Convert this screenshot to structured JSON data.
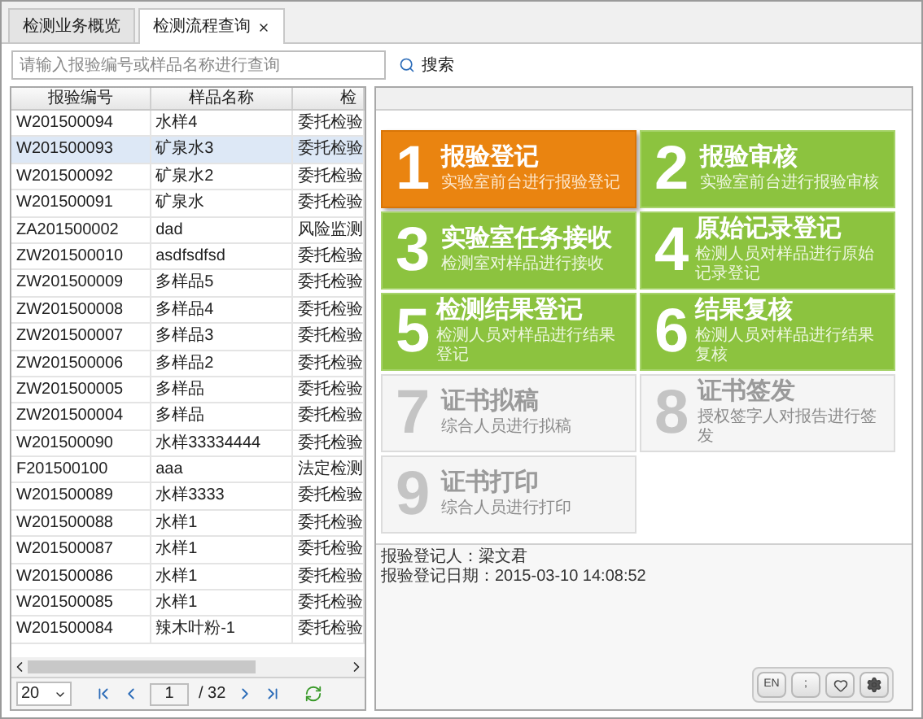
{
  "tabs": [
    {
      "label": "检测业务概览",
      "selected": false,
      "closable": false
    },
    {
      "label": "检测流程查询",
      "selected": true,
      "closable": true
    }
  ],
  "search": {
    "placeholder": "请输入报验编号或样品名称进行查询",
    "button": "搜索"
  },
  "table": {
    "columns": [
      "报验编号",
      "样品名称",
      "检"
    ],
    "rows": [
      {
        "cells": [
          "W201500094",
          "水样4",
          "委托检验"
        ],
        "selected": false
      },
      {
        "cells": [
          "W201500093",
          "矿泉水3",
          "委托检验"
        ],
        "selected": true
      },
      {
        "cells": [
          "W201500092",
          "矿泉水2",
          "委托检验"
        ],
        "selected": false
      },
      {
        "cells": [
          "W201500091",
          "矿泉水",
          "委托检验"
        ],
        "selected": false
      },
      {
        "cells": [
          "ZA201500002",
          "dad",
          "风险监测"
        ],
        "selected": false
      },
      {
        "cells": [
          "ZW201500010",
          "asdfsdfsd",
          "委托检验"
        ],
        "selected": false
      },
      {
        "cells": [
          "ZW201500009",
          "多样品5",
          "委托检验"
        ],
        "selected": false
      },
      {
        "cells": [
          "ZW201500008",
          "多样品4",
          "委托检验"
        ],
        "selected": false
      },
      {
        "cells": [
          "ZW201500007",
          "多样品3",
          "委托检验"
        ],
        "selected": false
      },
      {
        "cells": [
          "ZW201500006",
          "多样品2",
          "委托检验"
        ],
        "selected": false
      },
      {
        "cells": [
          "ZW201500005",
          "多样品",
          "委托检验"
        ],
        "selected": false
      },
      {
        "cells": [
          "ZW201500004",
          "多样品",
          "委托检验"
        ],
        "selected": false
      },
      {
        "cells": [
          "W201500090",
          "水样33334444",
          "委托检验"
        ],
        "selected": false
      },
      {
        "cells": [
          "F201500100",
          "aaa",
          "法定检测"
        ],
        "selected": false
      },
      {
        "cells": [
          "W201500089",
          "水样3333",
          "委托检验"
        ],
        "selected": false
      },
      {
        "cells": [
          "W201500088",
          "水样1",
          "委托检验"
        ],
        "selected": false
      },
      {
        "cells": [
          "W201500087",
          "水样1",
          "委托检验"
        ],
        "selected": false
      },
      {
        "cells": [
          "W201500086",
          "水样1",
          "委托检验"
        ],
        "selected": false
      },
      {
        "cells": [
          "W201500085",
          "水样1",
          "委托检验"
        ],
        "selected": false
      },
      {
        "cells": [
          "W201500084",
          "辣木叶粉-1",
          "委托检验"
        ],
        "selected": false
      }
    ]
  },
  "pager": {
    "page_size": "20",
    "page": "1",
    "total": "/ 32"
  },
  "steps": [
    {
      "number": "1",
      "title": "报验登记",
      "subtitle": "实验室前台进行报验登记",
      "selected": true,
      "disabled": false
    },
    {
      "number": "2",
      "title": "报验审核",
      "subtitle": "实验室前台进行报验审核",
      "selected": false,
      "disabled": false
    },
    {
      "number": "3",
      "title": "实验室任务接收",
      "subtitle": "检测室对样品进行接收",
      "selected": false,
      "disabled": false
    },
    {
      "number": "4",
      "title": "原始记录登记",
      "subtitle": "检测人员对样品进行原始记录登记",
      "selected": false,
      "disabled": false
    },
    {
      "number": "5",
      "title": "检测结果登记",
      "subtitle": "检测人员对样品进行结果登记",
      "selected": false,
      "disabled": false
    },
    {
      "number": "6",
      "title": "结果复核",
      "subtitle": "检测人员对样品进行结果复核",
      "selected": false,
      "disabled": false
    },
    {
      "number": "7",
      "title": "证书拟稿",
      "subtitle": "综合人员进行拟稿",
      "selected": false,
      "disabled": true
    },
    {
      "number": "8",
      "title": "证书签发",
      "subtitle": "授权签字人对报告进行签发",
      "selected": false,
      "disabled": true
    },
    {
      "number": "9",
      "title": "证书打印",
      "subtitle": "综合人员进行打印",
      "selected": false,
      "disabled": true
    }
  ],
  "info": [
    "报验登记人：梁文君",
    "报验登记日期：2015-03-10 14:08:52"
  ],
  "toolbar": [
    {
      "kind": "text",
      "label": "EN"
    },
    {
      "kind": "text",
      "label": ";"
    },
    {
      "kind": "heart"
    },
    {
      "kind": "gear"
    }
  ]
}
